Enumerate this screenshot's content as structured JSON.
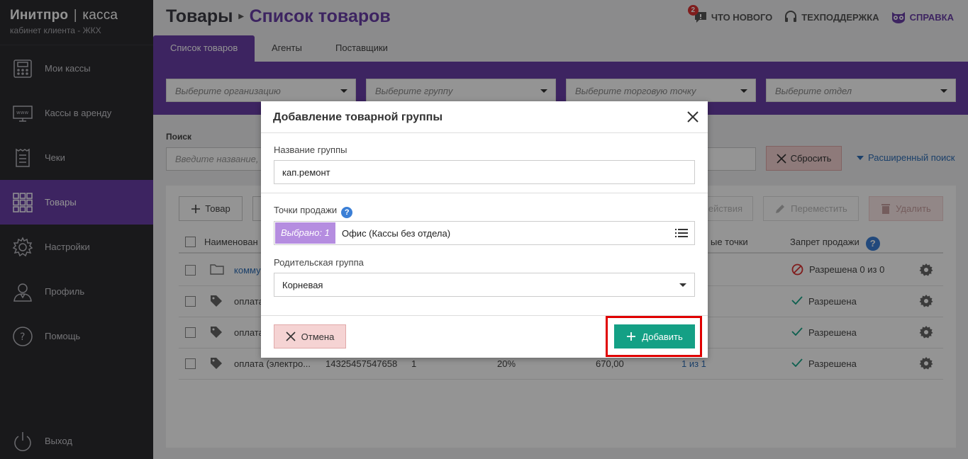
{
  "brand": {
    "title_bold": "Инитпро",
    "separator": "|",
    "title_light": "касса",
    "subtitle": "кабинет клиента - ЖКХ"
  },
  "sidebar": {
    "items": [
      {
        "label": "Мои кассы",
        "icon": "cash-register-icon"
      },
      {
        "label": "Кассы в аренду",
        "icon": "monitor-www-icon"
      },
      {
        "label": "Чеки",
        "icon": "receipt-icon"
      },
      {
        "label": "Товары",
        "icon": "grid-icon",
        "active": true
      },
      {
        "label": "Настройки",
        "icon": "gear-icon"
      },
      {
        "label": "Профиль",
        "icon": "user-icon"
      },
      {
        "label": "Помощь",
        "icon": "question-circle-icon"
      }
    ],
    "logout": "Выход"
  },
  "header": {
    "breadcrumb_root": "Товары",
    "breadcrumb_current": "Список товаров",
    "whats_new": "ЧТО НОВОГО",
    "whats_new_badge": "2",
    "support": "ТЕХПОДДЕРЖКА",
    "help": "СПРАВКА"
  },
  "tabs": [
    "Список товаров",
    "Агенты",
    "Поставщики"
  ],
  "filters": {
    "organization": "Выберите организацию",
    "group": "Выберите группу",
    "point": "Выберите торговую точку",
    "department": "Выберите отдел"
  },
  "search": {
    "label": "Поиск",
    "placeholder": "Введите название, а",
    "reset": "Сбросить",
    "advanced": "Расширенный поиск"
  },
  "toolbar": {
    "add_item": "Товар",
    "actions": "ействия",
    "move": "Переместить",
    "delete": "Удалить"
  },
  "table": {
    "headers": {
      "name": "Наименован",
      "points": "ые точки",
      "ban": "Запрет продажи"
    },
    "rows": [
      {
        "type": "folder",
        "name": "комму",
        "barcode": "",
        "qty": "",
        "vat": "",
        "price": "",
        "points": "",
        "status": "Разрешена 0 из 0",
        "status_type": "blocked"
      },
      {
        "type": "item",
        "name": "оплата",
        "barcode": "",
        "qty": "",
        "vat": "",
        "price": "",
        "points": "",
        "status": "Разрешена",
        "status_type": "ok"
      },
      {
        "type": "item",
        "name": "оплата",
        "barcode": "",
        "qty": "",
        "vat": "",
        "price": "",
        "points": "",
        "status": "Разрешена",
        "status_type": "ok"
      },
      {
        "type": "item",
        "name": "оплата (электро...",
        "barcode": "14325457547658",
        "qty": "1",
        "vat": "20%",
        "price": "670,00",
        "points": "1 из 1",
        "status": "Разрешена",
        "status_type": "ok"
      }
    ]
  },
  "modal": {
    "title": "Добавление товарной группы",
    "name_label": "Название группы",
    "name_value": "кап.ремонт",
    "points_label": "Точки продажи",
    "chip": "Выбрано: 1",
    "points_value": "Офис (Кассы без отдела)",
    "parent_label": "Родительская группа",
    "parent_value": "Корневая",
    "cancel": "Отмена",
    "add": "Добавить"
  },
  "colors": {
    "accent": "#6a3fa8",
    "sidebar": "#2b2b2f",
    "add_button": "#14a085",
    "highlight": "#e00000"
  }
}
